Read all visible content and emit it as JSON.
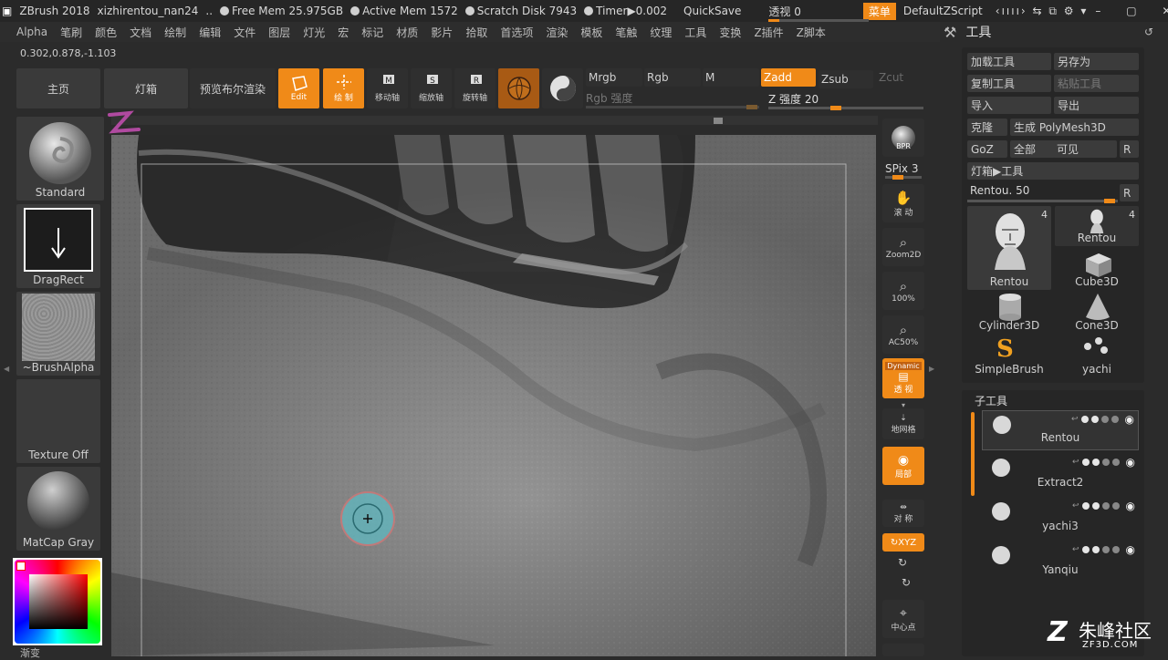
{
  "titlebar": {
    "app": "ZBrush 2018",
    "file": "xizhirentou_nan24",
    "sep": "..",
    "free_mem": "Free Mem 25.975GB",
    "active_mem": "Active Mem 1572",
    "scratch": "Scratch Disk 7943",
    "timer": "Timer▶0.002",
    "quicksave": "QuickSave",
    "perspective": "透视  0",
    "menu_label": "菜单",
    "script": "DefaultZScript"
  },
  "menubar": [
    "Alpha",
    "笔刷",
    "颜色",
    "文档",
    "绘制",
    "编辑",
    "文件",
    "图层",
    "灯光",
    "宏",
    "标记",
    "材质",
    "影片",
    "拾取",
    "首选项",
    "渲染",
    "模板",
    "笔触",
    "纹理",
    "工具",
    "变换",
    "Z插件",
    "Z脚本"
  ],
  "coords": "0.302,0.878,-1.103",
  "top_buttons": {
    "home": "主页",
    "lightbox": "灯箱",
    "bpr_preview": "预览布尔渲染",
    "edit": "Edit",
    "draw": "绘 制",
    "move": "移动轴",
    "scale": "缩放轴",
    "rotate": "旋转轴",
    "mrgb": "Mrgb",
    "rgb": "Rgb",
    "m": "M",
    "zadd": "Zadd",
    "zsub": "Zsub",
    "zcut": "Zcut",
    "rgb_intensity": "Rgb 强度",
    "z_intensity": "Z 强度 20"
  },
  "left_shelf": {
    "brush": "Standard",
    "stroke": "DragRect",
    "alpha": "~BrushAlpha",
    "texture": "Texture Off",
    "material": "MatCap Gray",
    "gradient": "渐变"
  },
  "right_shelf": {
    "bpr": "BPR",
    "spix": "SPix 3",
    "scroll": "滚 动",
    "zoom2d": "Zoom2D",
    "zoom100": "100%",
    "ac50": "AC50%",
    "dynamic": "Dynamic",
    "perspective": "透 视",
    "floor": "地网格",
    "local": "局部",
    "symmetry": "对 称",
    "xyz": "XYZ",
    "center": "中心点"
  },
  "tool_panel": {
    "title": "工具",
    "load": "加载工具",
    "save_as": "另存为",
    "copy": "复制工具",
    "paste": "粘贴工具",
    "import": "导入",
    "export": "导出",
    "clone": "克隆",
    "polymesh": "生成 PolyMesh3D",
    "goz": "GoZ",
    "all": "全部",
    "visible": "可见",
    "r": "R",
    "lightbox_tool": "灯箱▶工具",
    "rentou_slider": "Rentou. 50",
    "tools": [
      {
        "name": "Rentou",
        "count": "4"
      },
      {
        "name": "Rentou",
        "count": "4"
      },
      {
        "name": "Cube3D"
      },
      {
        "name": "Cylinder3D"
      },
      {
        "name": "Cone3D"
      },
      {
        "name": "SimpleBrush"
      },
      {
        "name": "yachi"
      }
    ],
    "subtool_title": "子工具",
    "subtools": [
      "Rentou",
      "Extract2",
      "yachi3",
      "Yanqiu"
    ]
  },
  "watermark": {
    "brand": "朱峰社区",
    "url": "ZF3D.COM"
  },
  "colors": {
    "accent": "#f08a18",
    "panel": "#2b2b2b",
    "button": "#3a3a3a"
  }
}
